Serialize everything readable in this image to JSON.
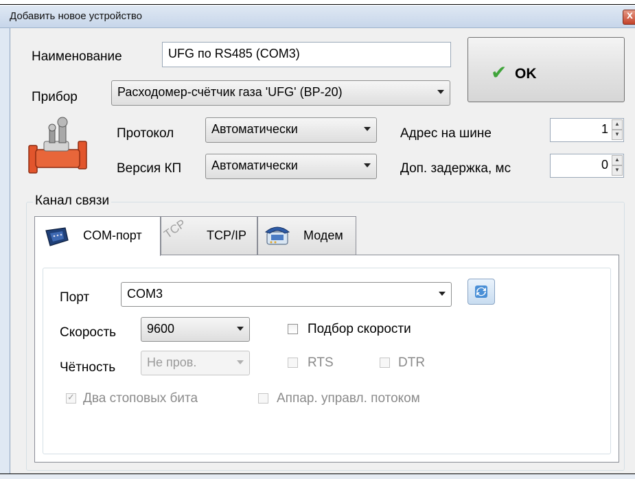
{
  "window": {
    "title": "Добавить новое устройство",
    "close_glyph": "x"
  },
  "form": {
    "name_label": "Наименование",
    "name_value": "UFG по RS485 (COM3)",
    "device_label": "Прибор",
    "device_value": "Расходомер-счётчик газа 'UFG' (ВР-20)",
    "protocol_label": "Протокол",
    "protocol_value": "Автоматически",
    "kp_version_label": "Версия КП",
    "kp_version_value": "Автоматически",
    "bus_address_label": "Адрес на шине",
    "bus_address_value": "1",
    "extra_delay_label": "Доп. задержка, мс",
    "extra_delay_value": "0"
  },
  "ok_button": {
    "label": "OK",
    "icon": "checkmark-icon"
  },
  "device_icon": "gas-meter-icon",
  "channel": {
    "group_label": "Канал связи",
    "tabs": [
      {
        "label": "COM-порт",
        "icon": "serial-port-icon",
        "selected": true
      },
      {
        "label": "TCP/IP",
        "icon": "tcp-icon",
        "selected": false
      },
      {
        "label": "Модем",
        "icon": "modem-phone-icon",
        "selected": false
      }
    ]
  },
  "com": {
    "port_label": "Порт",
    "port_value": "COM3",
    "refresh_icon": "refresh-icon",
    "speed_label": "Скорость",
    "speed_value": "9600",
    "speed_auto_label": "Подбор скорости",
    "speed_auto_checked": false,
    "parity_label": "Чётность",
    "parity_value": "Не пров.",
    "rts_label": "RTS",
    "dtr_label": "DTR",
    "stop_bits_label": "Два стоповых бита",
    "stop_bits_checked": true,
    "flow_control_label": "Аппар. управл. потоком"
  },
  "colors": {
    "title_bar": "#c7d6ea",
    "dialog_bg": "#f0f0f0",
    "ok_check": "#3fa43a",
    "device_orange": "#e2552c"
  }
}
